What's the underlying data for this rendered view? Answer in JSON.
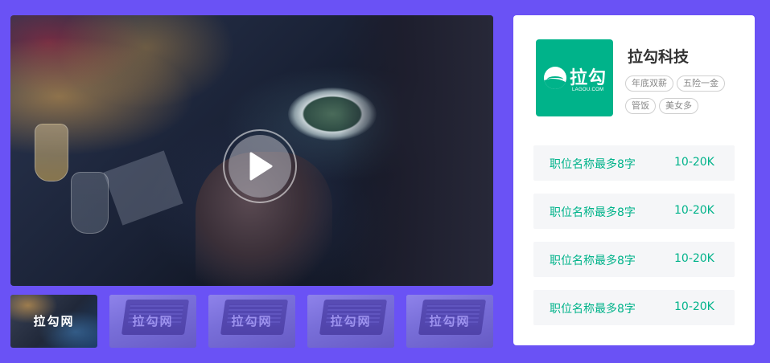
{
  "video": {
    "play_icon": "play-icon"
  },
  "thumbnails": [
    {
      "label": "拉勾网",
      "active": true
    },
    {
      "label": "拉勾网",
      "active": false
    },
    {
      "label": "拉勾网",
      "active": false
    },
    {
      "label": "拉勾网",
      "active": false
    },
    {
      "label": "拉勾网",
      "active": false
    }
  ],
  "company": {
    "logo_text": "拉勾",
    "logo_subtext": "LAGOU.COM",
    "name": "拉勾科技",
    "tags": [
      "年底双薪",
      "五险一金",
      "管饭",
      "美女多"
    ]
  },
  "jobs": [
    {
      "title": "职位名称最多8字",
      "salary": "10-20K"
    },
    {
      "title": "职位名称最多8字",
      "salary": "10-20K"
    },
    {
      "title": "职位名称最多8字",
      "salary": "10-20K"
    },
    {
      "title": "职位名称最多8字",
      "salary": "10-20K"
    }
  ],
  "colors": {
    "background": "#6a52f5",
    "accent": "#00b38a",
    "thumbnail_overlay": "#6c56f6"
  }
}
